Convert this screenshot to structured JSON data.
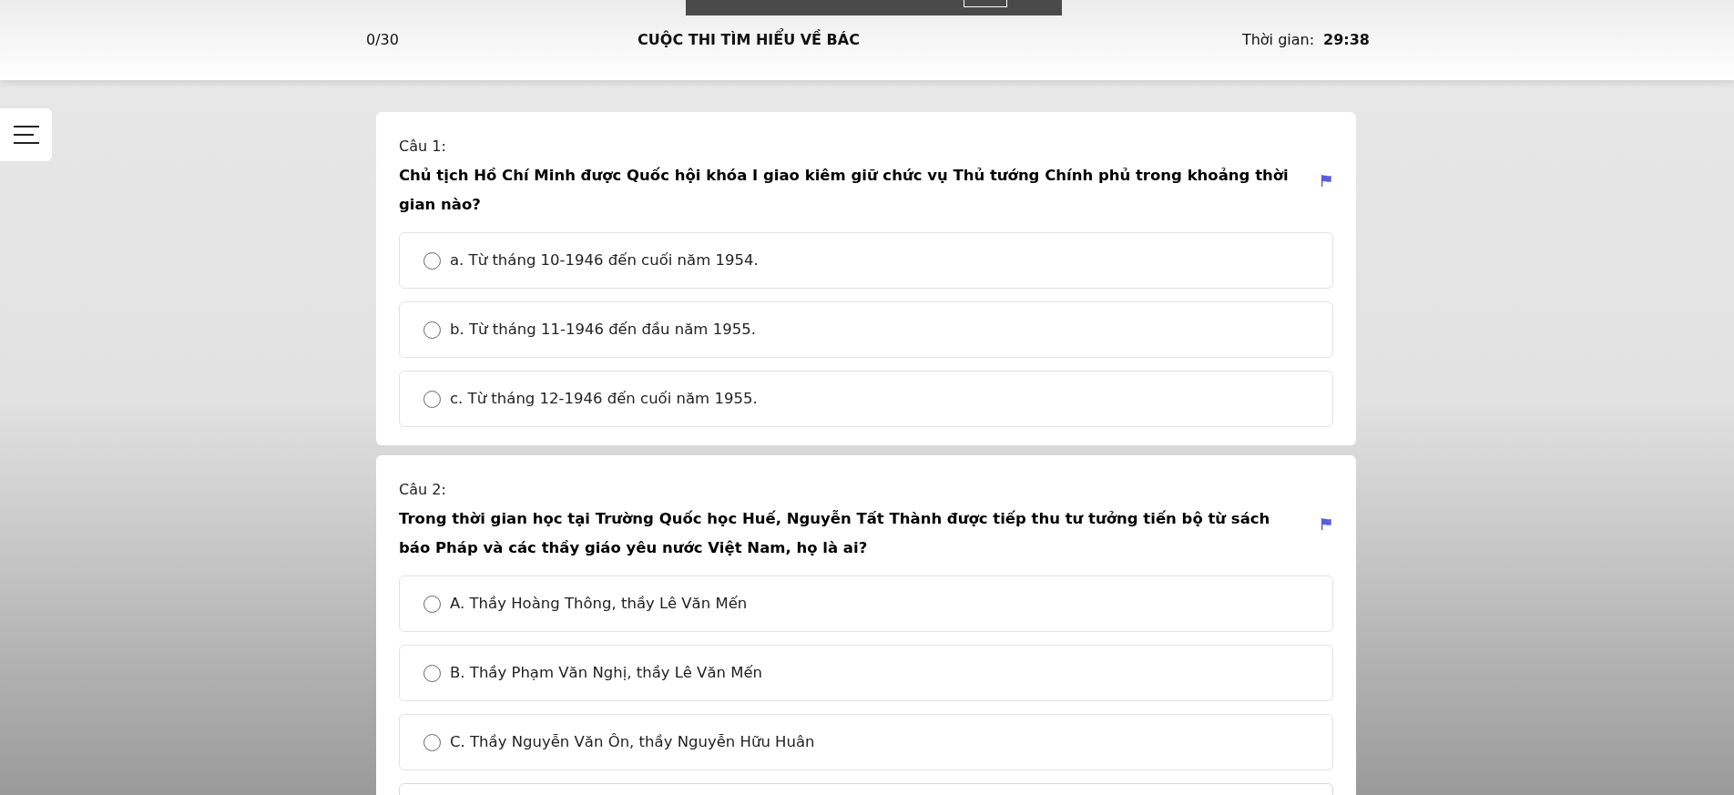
{
  "header": {
    "progress": "0/30",
    "title": "CUỘC THI TÌM HIỂU VỀ BÁC",
    "timer_label": "Thời gian:",
    "timer_value": "29:38"
  },
  "questions": [
    {
      "label": "Câu 1:",
      "text": "Chủ tịch Hồ Chí Minh được Quốc hội khóa I giao kiêm giữ chức vụ Thủ tướng Chính phủ trong khoảng thời gian nào?",
      "options": [
        {
          "text": "a. Từ tháng 10-1946 đến cuối năm 1954.",
          "selected": false
        },
        {
          "text": "b. Từ tháng 11-1946 đến đầu năm 1955.",
          "selected": false
        },
        {
          "text": "c. Từ tháng 12-1946 đến cuối năm 1955.",
          "selected": false
        }
      ]
    },
    {
      "label": "Câu 2:",
      "text": "Trong thời gian học tại Trường Quốc học Huế, Nguyễn Tất Thành được tiếp thu tư tưởng tiến bộ từ sách báo Pháp và các thầy giáo yêu nước Việt Nam, họ là ai?",
      "options": [
        {
          "text": "A. Thầy Hoàng Thông, thầy Lê Văn Mến",
          "selected": false
        },
        {
          "text": "B. Thầy Phạm Văn Nghị, thầy Lê Văn Mến",
          "selected": false
        },
        {
          "text": "C. Thầy Nguyễn Văn Ôn, thầy Nguyễn Hữu Huân",
          "selected": false
        }
      ]
    }
  ]
}
